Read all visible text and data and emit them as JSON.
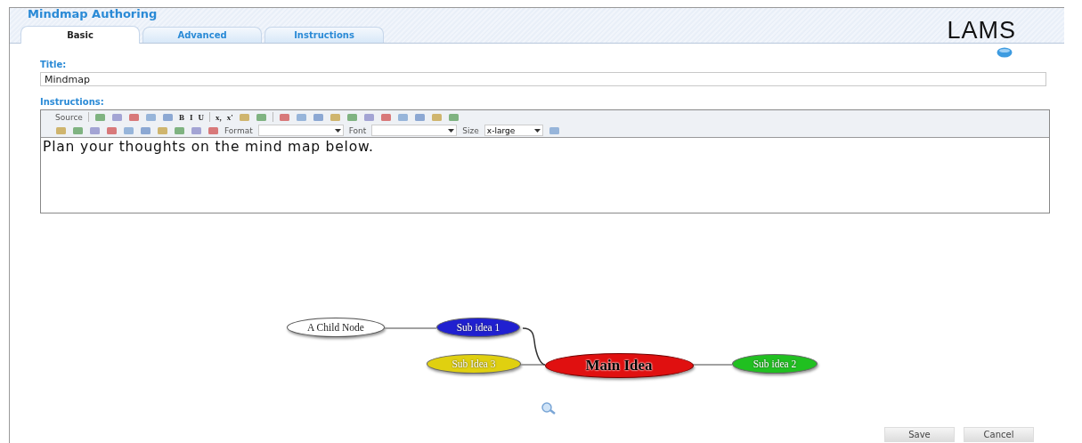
{
  "header": {
    "title": "Mindmap Authoring",
    "logo": "LAMS"
  },
  "tabs": [
    {
      "label": "Basic",
      "selected": true
    },
    {
      "label": "Advanced",
      "selected": false
    },
    {
      "label": "Instructions",
      "selected": false
    }
  ],
  "title_field": {
    "label": "Title:",
    "value": "Mindmap"
  },
  "instructions": {
    "label": "Instructions:",
    "text": "Plan your thoughts on the mind map below."
  },
  "toolbar_rows": [
    [
      {
        "kind": "label",
        "text": "Source"
      },
      {
        "kind": "sep"
      },
      {
        "kind": "icon"
      },
      {
        "kind": "icon"
      },
      {
        "kind": "icon"
      },
      {
        "kind": "icon"
      },
      {
        "kind": "icon"
      },
      {
        "kind": "glyph",
        "text": "B"
      },
      {
        "kind": "glyph",
        "text": "I"
      },
      {
        "kind": "glyph",
        "text": "U"
      },
      {
        "kind": "sep"
      },
      {
        "kind": "glyph",
        "text": "x,"
      },
      {
        "kind": "glyph",
        "text": "x'"
      },
      {
        "kind": "icon"
      },
      {
        "kind": "icon"
      },
      {
        "kind": "sep"
      },
      {
        "kind": "icon"
      },
      {
        "kind": "icon"
      },
      {
        "kind": "icon"
      },
      {
        "kind": "icon"
      },
      {
        "kind": "icon"
      },
      {
        "kind": "icon"
      },
      {
        "kind": "icon"
      },
      {
        "kind": "icon"
      },
      {
        "kind": "icon"
      },
      {
        "kind": "icon"
      },
      {
        "kind": "icon"
      }
    ],
    [
      {
        "kind": "icon"
      },
      {
        "kind": "icon"
      },
      {
        "kind": "icon"
      },
      {
        "kind": "icon"
      },
      {
        "kind": "icon"
      },
      {
        "kind": "icon"
      },
      {
        "kind": "icon"
      },
      {
        "kind": "icon"
      },
      {
        "kind": "icon"
      },
      {
        "kind": "icon"
      },
      {
        "kind": "label",
        "text": "Format"
      },
      {
        "kind": "select"
      },
      {
        "kind": "label",
        "text": "Font"
      },
      {
        "kind": "select"
      },
      {
        "kind": "label",
        "text": "Size"
      },
      {
        "kind": "select",
        "value": "x-large"
      },
      {
        "kind": "icon"
      }
    ]
  ],
  "mindmap": {
    "label": "Main Idea",
    "color": "#e01010",
    "children": [
      {
        "label": "Sub idea 1",
        "color": "#2020d0",
        "children": [
          {
            "label": "A Child Node",
            "color": "#ffffff"
          }
        ]
      },
      {
        "label": "Sub idea 2",
        "color": "#20c020"
      },
      {
        "label": "Sub Idea 3",
        "color": "#e0d010"
      }
    ]
  },
  "buttons": [
    "Save",
    "Cancel"
  ]
}
